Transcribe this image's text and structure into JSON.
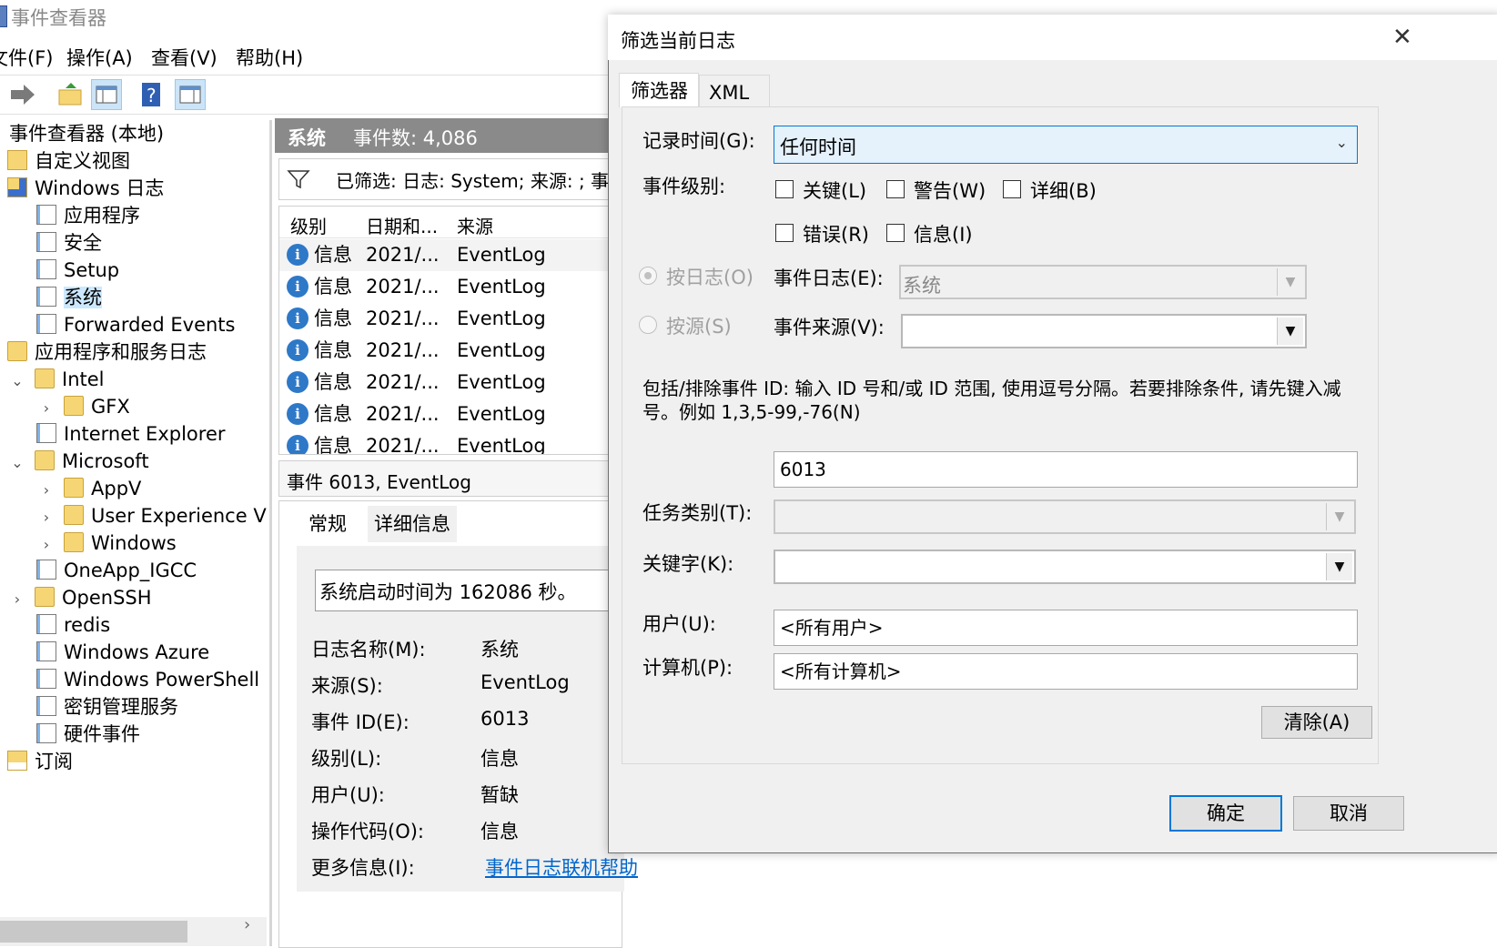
{
  "window": {
    "title": "事件查看器"
  },
  "menu": [
    "文件(F)",
    "操作(A)",
    "查看(V)",
    "帮助(H)"
  ],
  "tree": {
    "root": "事件查看器 (本地)",
    "custom_views": "自定义视图",
    "windows_logs": "Windows 日志",
    "logs": [
      "应用程序",
      "安全",
      "Setup",
      "系统",
      "Forwarded Events"
    ],
    "app_services": "应用程序和服务日志",
    "intel": "Intel",
    "gfx": "GFX",
    "ie": "Internet Explorer",
    "microsoft": "Microsoft",
    "appv": "AppV",
    "uev": "User Experience Virtu",
    "windows": "Windows",
    "oneapp": "OneApp_IGCC",
    "openssh": "OpenSSH",
    "redis": "redis",
    "azure": "Windows Azure",
    "powershell": "Windows PowerShell",
    "kms": "密钥管理服务",
    "hardware": "硬件事件",
    "subscriptions": "订阅"
  },
  "center": {
    "log_name": "系统",
    "event_count": "事件数: 4,086",
    "filter_text": "已筛选: 日志: System; 来源: ; 事",
    "columns": [
      "级别",
      "日期和...",
      "来源"
    ],
    "rows": [
      {
        "level": "信息",
        "date": "2021/...",
        "source": "EventLog"
      },
      {
        "level": "信息",
        "date": "2021/...",
        "source": "EventLog"
      },
      {
        "level": "信息",
        "date": "2021/...",
        "source": "EventLog"
      },
      {
        "level": "信息",
        "date": "2021/...",
        "source": "EventLog"
      },
      {
        "level": "信息",
        "date": "2021/...",
        "source": "EventLog"
      },
      {
        "level": "信息",
        "date": "2021/...",
        "source": "EventLog"
      },
      {
        "level": "信息",
        "date": "2021/...",
        "source": "EventLog"
      }
    ],
    "detail_title": "事件 6013, EventLog",
    "tabs": [
      "常规",
      "详细信息"
    ],
    "message": "系统启动时间为 162086 秒。",
    "fields": [
      {
        "label": "日志名称(M):",
        "value": "系统"
      },
      {
        "label": "来源(S):",
        "value": "EventLog"
      },
      {
        "label": "事件 ID(E):",
        "value": "6013"
      },
      {
        "label": "级别(L):",
        "value": "信息"
      },
      {
        "label": "用户(U):",
        "value": "暂缺"
      },
      {
        "label": "操作代码(O):",
        "value": "信息"
      },
      {
        "label": "更多信息(I):",
        "value": "事件日志联机帮助"
      }
    ]
  },
  "dialog": {
    "title": "筛选当前日志",
    "tabs": [
      "筛选器",
      "XML"
    ],
    "logged_label": "记录时间(G):",
    "logged_value": "任何时间",
    "level_label": "事件级别:",
    "levels": [
      "关键(L)",
      "警告(W)",
      "详细(B)",
      "错误(R)",
      "信息(I)"
    ],
    "by_log": "按日志(O)",
    "by_source": "按源(S)",
    "event_log_label": "事件日志(E):",
    "event_log_value": "系统",
    "event_source_label": "事件来源(V):",
    "id_help": "包括/排除事件 ID: 输入 ID 号和/或 ID 范围, 使用逗号分隔。若要排除条件, 请先键入减号。例如 1,3,5-99,-76(N)",
    "event_id_value": "6013",
    "task_label": "任务类别(T):",
    "keywords_label": "关键字(K):",
    "user_label": "用户(U):",
    "user_value": "<所有用户>",
    "computer_label": "计算机(P):",
    "computer_value": "<所有计算机>",
    "clear_btn": "清除(A)",
    "ok_btn": "确定",
    "cancel_btn": "取消"
  },
  "colors": {
    "accent": "#0078d7",
    "header_gray": "#8a8a8a",
    "selected": "#cce8ff",
    "link": "#0066cc"
  }
}
